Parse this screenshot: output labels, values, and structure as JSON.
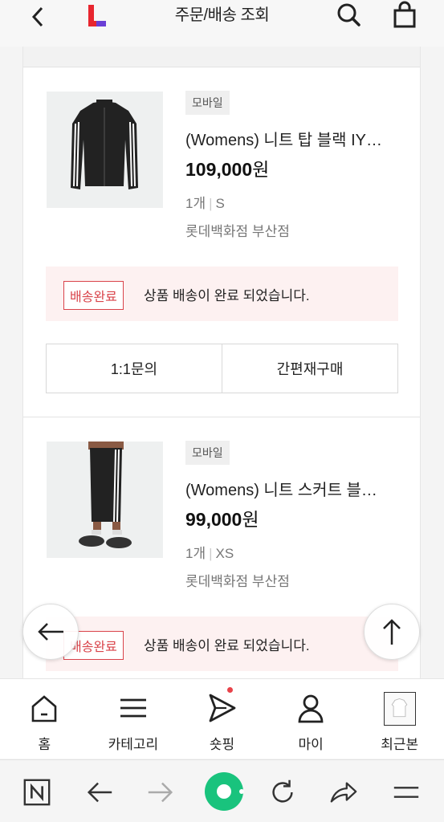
{
  "header": {
    "title": "주문/배송 조회",
    "logo_color": "#e8262f",
    "logo_accent": "#6a3fd6"
  },
  "orders": [
    {
      "channel_badge": "모바일",
      "name": "(Womens) 니트 탑 블랙 IY…",
      "price": "109,000",
      "currency": "원",
      "quantity": "1개",
      "size": "S",
      "store": "롯데백화점 부산점",
      "status_badge": "배송완료",
      "status_text": "상품 배송이 완료 되었습니다.",
      "buttons": [
        "1:1문의",
        "간편재구매"
      ]
    },
    {
      "channel_badge": "모바일",
      "name": "(Womens) 니트 스커트 블…",
      "price": "99,000",
      "currency": "원",
      "quantity": "1개",
      "size": "XS",
      "store": "롯데백화점 부산점",
      "status_badge": "배송완료",
      "status_text": "상품 배송이 완료 되었습니다."
    }
  ],
  "bottom_nav": [
    {
      "label": "홈",
      "icon": "home-icon"
    },
    {
      "label": "카테고리",
      "icon": "menu-icon"
    },
    {
      "label": "숏핑",
      "icon": "play-icon",
      "has_dot": true
    },
    {
      "label": "마이",
      "icon": "person-icon"
    },
    {
      "label": "최근본",
      "icon": "recent-thumbnail"
    }
  ],
  "browser_toolbar": [
    "naver-n-icon",
    "back-arrow-icon",
    "forward-arrow-icon",
    "green-dot-icon",
    "refresh-icon",
    "share-icon",
    "menu-icon"
  ],
  "colors": {
    "status_red": "#d9434a",
    "status_bg": "#fdf1f1",
    "green": "#19c37d"
  }
}
